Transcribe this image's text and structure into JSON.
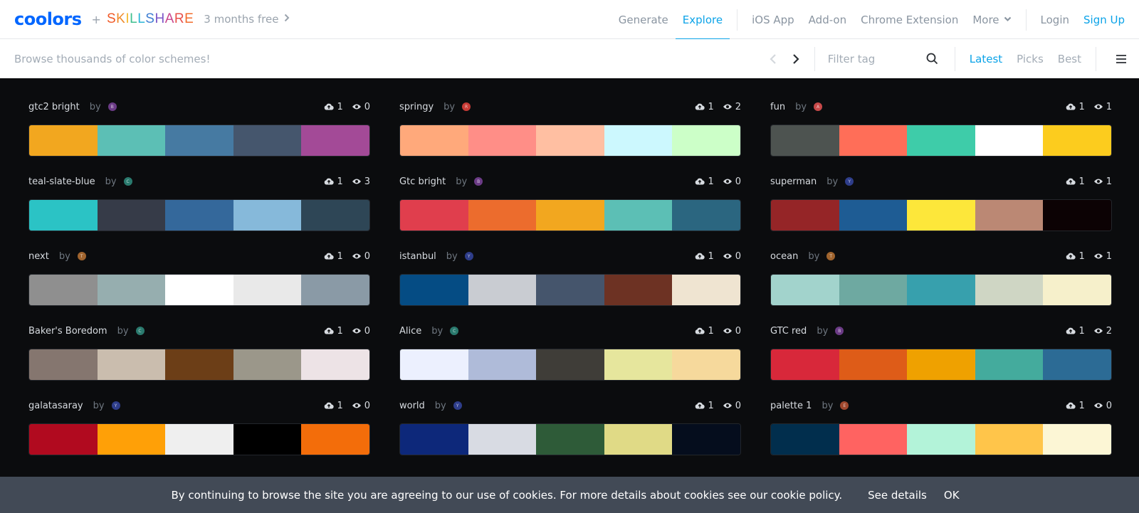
{
  "nav": {
    "logo": "coolors",
    "plus": "+",
    "partner": "SKILLSHARE",
    "promo": "3 months free",
    "links": [
      "Generate",
      "Explore",
      "iOS App",
      "Add-on",
      "Chrome Extension",
      "More",
      "Login",
      "Sign Up"
    ],
    "active": "Explore"
  },
  "subbar": {
    "browse_placeholder": "Browse thousands of color schemes!",
    "filter_placeholder": "Filter tag",
    "sort": [
      "Latest",
      "Picks",
      "Best"
    ],
    "sort_active": "Latest"
  },
  "palettes": [
    {
      "name": "gtc2 bright",
      "by": "by",
      "avatar": "#6b3b86",
      "avatar_letter": "B",
      "saves": "1",
      "views": "0",
      "colors": [
        "#f2a71f",
        "#5cbfb5",
        "#467aa2",
        "#45566d",
        "#a34a97"
      ]
    },
    {
      "name": "springy",
      "by": "by",
      "avatar": "#c83b36",
      "avatar_letter": "R",
      "saves": "1",
      "views": "2",
      "colors": [
        "#ffa97b",
        "#ff8e87",
        "#ffbfa2",
        "#ccf8fe",
        "#ccffc8"
      ]
    },
    {
      "name": "fun",
      "by": "by",
      "avatar": "#c84a4a",
      "avatar_letter": "A",
      "saves": "1",
      "views": "1",
      "colors": [
        "#4d5350",
        "#ff6e58",
        "#3ecca9",
        "#ffffff",
        "#fccc1e"
      ]
    },
    {
      "name": "teal-slate-blue",
      "by": "by",
      "avatar": "#2a7a6e",
      "avatar_letter": "C",
      "saves": "1",
      "views": "3",
      "colors": [
        "#2bc3c5",
        "#363b48",
        "#34689b",
        "#86b9da",
        "#2e4656"
      ]
    },
    {
      "name": "Gtc bright",
      "by": "by",
      "avatar": "#6b3b86",
      "avatar_letter": "B",
      "saves": "1",
      "views": "0",
      "colors": [
        "#e03e4d",
        "#ec6c2d",
        "#f2a71f",
        "#5cbfb5",
        "#2b6680"
      ]
    },
    {
      "name": "superman",
      "by": "by",
      "avatar": "#2e3d8a",
      "avatar_letter": "Y",
      "saves": "1",
      "views": "1",
      "colors": [
        "#952527",
        "#1e5c94",
        "#fde73a",
        "#bb8874",
        "#0c0204"
      ]
    },
    {
      "name": "next",
      "by": "by",
      "avatar": "#a0642e",
      "avatar_letter": "T",
      "saves": "1",
      "views": "0",
      "colors": [
        "#8f8f8f",
        "#96aeaf",
        "#ffffff",
        "#e9e9e9",
        "#8a9aa6"
      ]
    },
    {
      "name": "istanbul",
      "by": "by",
      "avatar": "#2e3d8a",
      "avatar_letter": "Y",
      "saves": "1",
      "views": "0",
      "colors": [
        "#054c84",
        "#c9ccd2",
        "#45556c",
        "#6d3223",
        "#efe4d1"
      ]
    },
    {
      "name": "ocean",
      "by": "by",
      "avatar": "#a0642e",
      "avatar_letter": "T",
      "saves": "1",
      "views": "1",
      "colors": [
        "#a2d3cc",
        "#6ea9a1",
        "#37a0ad",
        "#cfd6c4",
        "#f6f0cb"
      ]
    },
    {
      "name": "Baker's Boredom",
      "by": "by",
      "avatar": "#2a7a6e",
      "avatar_letter": "C",
      "saves": "1",
      "views": "0",
      "colors": [
        "#85766f",
        "#cabdae",
        "#6c3e17",
        "#9b978a",
        "#ede3e6"
      ]
    },
    {
      "name": "Alice",
      "by": "by",
      "avatar": "#2a7a6e",
      "avatar_letter": "C",
      "saves": "1",
      "views": "0",
      "colors": [
        "#ecf0fe",
        "#afbbd9",
        "#3f3d38",
        "#e6e69d",
        "#f6d99c"
      ]
    },
    {
      "name": "GTC red",
      "by": "by",
      "avatar": "#6b3b86",
      "avatar_letter": "B",
      "saves": "1",
      "views": "2",
      "colors": [
        "#d8283a",
        "#de5c18",
        "#efa100",
        "#44ab9d",
        "#2c6b95"
      ]
    },
    {
      "name": "galatasaray",
      "by": "by",
      "avatar": "#2e3d8a",
      "avatar_letter": "Y",
      "saves": "1",
      "views": "0",
      "colors": [
        "#b10a1f",
        "#ffa007",
        "#efefef",
        "#000000",
        "#f36d0a"
      ]
    },
    {
      "name": "world",
      "by": "by",
      "avatar": "#2e3d8a",
      "avatar_letter": "Y",
      "saves": "1",
      "views": "0",
      "colors": [
        "#0d287a",
        "#d8dbe3",
        "#2e5b38",
        "#e0da86",
        "#050d1d"
      ]
    },
    {
      "name": "palette 1",
      "by": "by",
      "avatar": "#a0482e",
      "avatar_letter": "E",
      "saves": "1",
      "views": "0",
      "colors": [
        "#012e4d",
        "#ff6361",
        "#b3f3d9",
        "#ffc54a",
        "#fcf6d5"
      ]
    }
  ],
  "cookie": {
    "message": "By continuing to browse the site you are agreeing to our use of cookies. For more details about cookies see our cookie policy.",
    "details": "See details",
    "ok": "OK"
  },
  "colors": {
    "accent": "#0ba3e8",
    "logo": "#0066ff",
    "background": "#0b0c0e",
    "cookie_bg": "#424a56"
  }
}
